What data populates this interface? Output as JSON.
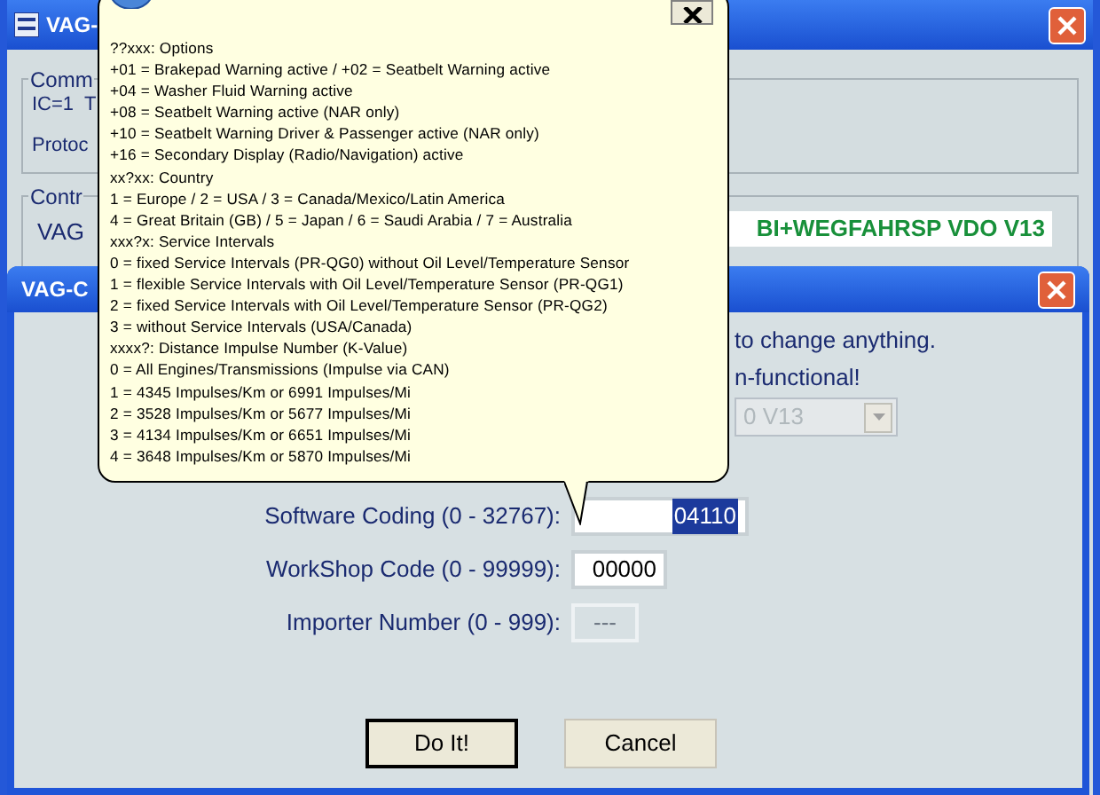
{
  "main_window": {
    "title": "VAG-",
    "group_1": {
      "title": "Comm",
      "lines": [
        "IC=1  T",
        "Protoc"
      ]
    },
    "group_2": {
      "title": "Contr",
      "label": "VAG",
      "value": "BI+WEGFAHRSP VDO V13"
    }
  },
  "dialog": {
    "title": "VAG-C",
    "warning_lines": [
      "to change anything.",
      "n-functional!"
    ],
    "controller_select": {
      "value": "0 V13",
      "disabled": true
    },
    "fields": [
      {
        "label": "Software Coding (0 - 32767):",
        "value": "04110",
        "selected": true,
        "disabled": false
      },
      {
        "label": "WorkShop Code (0 - 99999):",
        "value": "00000",
        "selected": false,
        "disabled": false
      },
      {
        "label": "Importer Number (0 - 999):",
        "value": "---",
        "selected": false,
        "disabled": true
      }
    ],
    "buttons": [
      {
        "label": "Do It!",
        "default": true
      },
      {
        "label": "Cancel",
        "default": false
      }
    ]
  },
  "tooltip": {
    "lines": [
      "??xxx: Options",
      "+01 = Brakepad Warning active / +02 = Seatbelt Warning active",
      "+04 = Washer Fluid Warning active",
      "+08 = Seatbelt Warning active (NAR only)",
      "+10 = Seatbelt Warning Driver & Passenger active (NAR only)",
      "+16 = Secondary Display (Radio/Navigation) active",
      "xx?xx: Country",
      "1 = Europe / 2 = USA / 3 = Canada/Mexico/Latin America",
      "4 = Great Britain (GB) / 5 = Japan / 6 = Saudi Arabia / 7 = Australia",
      "xxx?x: Service Intervals",
      "0 = fixed Service Intervals (PR-QG0) without Oil Level/Temperature Sensor",
      "1 = flexible Service Intervals with Oil Level/Temperature Sensor (PR-QG1)",
      "2 = fixed Service Intervals with Oil Level/Temperature Sensor (PR-QG2)",
      "3 = without Service Intervals (USA/Canada)",
      "xxxx?: Distance Impulse Number (K-Value)",
      "0 = All Engines/Transmissions (Impulse via CAN)",
      "1 = 4345 Impulses/Km or 6991 Impulses/Mi",
      "2 = 3528 Impulses/Km or 5677 Impulses/Mi",
      "3 = 4134 Impulses/Km or 6651 Impulses/Mi",
      "4 = 3648 Impulses/Km or 5870 Impulses/Mi"
    ]
  }
}
